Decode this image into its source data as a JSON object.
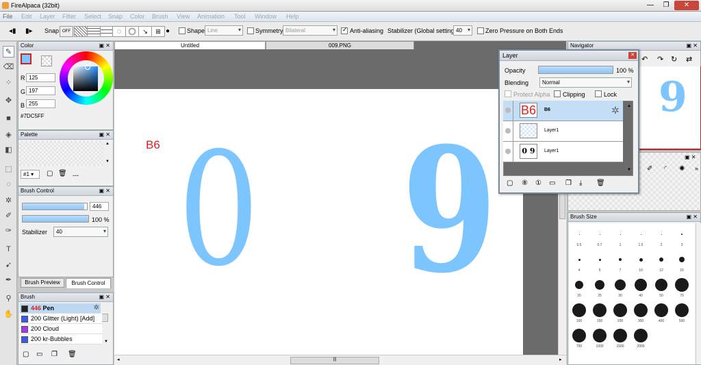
{
  "app": {
    "title": "FireAlpaca (32bit)"
  },
  "menu": [
    "File",
    "Edit",
    "Layer",
    "Filter",
    "Select",
    "Snap",
    "Color",
    "Brush",
    "View",
    "Animation",
    "Tool",
    "Window",
    "Help"
  ],
  "toolbar": {
    "snap": "Snap",
    "snap_off": "OFF",
    "shape": "Shape",
    "shape_value": "Line",
    "symmetry": "Symmetry",
    "symmetry_value": "Bilateral",
    "antialias": "Anti-aliasing",
    "stabilizer": "Stabilizer (Global settings)",
    "stabilizer_value": "40",
    "zero_pressure": "Zero Pressure on Both Ends"
  },
  "color_panel": {
    "title": "Color",
    "r_label": "R",
    "g_label": "G",
    "b_label": "B",
    "r": "125",
    "g": "197",
    "b": "255",
    "hex": "#7DC5FF",
    "color": "#7DC5FF"
  },
  "palette_panel": {
    "title": "Palette",
    "selector": "#1",
    "extra": "---"
  },
  "brush_control": {
    "title": "Brush Control",
    "size": "446",
    "opacity": "100 %",
    "stabilizer_label": "Stabilizer",
    "stabilizer_value": "40",
    "size_fill": 0.96,
    "opacity_fill": 1.0
  },
  "bottom_tabs": {
    "preview": "Brush Preview",
    "control": "Brush Control"
  },
  "brush_panel": {
    "title": "Brush",
    "items": [
      {
        "size": "446",
        "name": "Pen",
        "color": "#222222"
      },
      {
        "size": "200",
        "name": "Glitter (Light) [Add]",
        "color": "#3a5ae8"
      },
      {
        "size": "200",
        "name": "Cloud",
        "color": "#a838e8"
      },
      {
        "size": "200",
        "name": "kr-Bubbles",
        "color": "#3a5ae8"
      }
    ]
  },
  "tabs": [
    "Untitled",
    "009.PNG"
  ],
  "canvas": {
    "layer_label": "B6",
    "digit_left": "0",
    "digit_right": "9",
    "digit_color": "#7DC5FF",
    "label_color": "#e02020"
  },
  "layer_panel": {
    "title": "Layer",
    "opacity_label": "Opacity",
    "opacity": "100 %",
    "opacity_fill": 1.0,
    "blending_label": "Blending",
    "blending": "Normal",
    "protect_alpha": "Protect Alpha",
    "clipping": "Clipping",
    "lock": "Lock",
    "layers": [
      {
        "name": "B6",
        "thumb": "B6",
        "selected": true
      },
      {
        "name": "Layer1",
        "thumb": "",
        "selected": false
      },
      {
        "name": "Layer1",
        "thumb": "0 9",
        "selected": false
      }
    ]
  },
  "navigator": {
    "title": "Navigator",
    "preview_digit": "9"
  },
  "brush_size": {
    "title": "Brush Size",
    "sizes": [
      "0.5",
      "0.7",
      "1",
      "1.5",
      "2",
      "3",
      "4",
      "5",
      "7",
      "10",
      "12",
      "15",
      "20",
      "25",
      "30",
      "40",
      "50",
      "70",
      "100",
      "150",
      "200",
      "300",
      "400",
      "500",
      "700",
      "1000",
      "1500",
      "2000"
    ]
  }
}
